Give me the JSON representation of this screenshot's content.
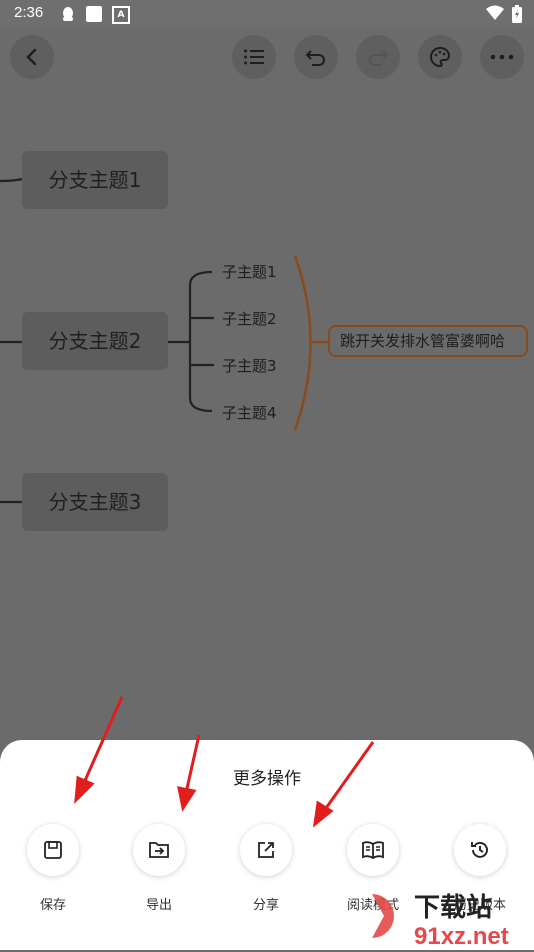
{
  "status_bar": {
    "time": "2:36"
  },
  "toolbar": {
    "back_icon": "chevron-left-icon",
    "outline_icon": "list-icon",
    "undo_icon": "undo-icon",
    "redo_icon": "redo-icon",
    "theme_icon": "palette-icon",
    "more_icon": "more-dots-icon"
  },
  "mindmap": {
    "branches": [
      "分支主题1",
      "分支主题2",
      "分支主题3"
    ],
    "subtopics": [
      "子主题1",
      "子主题2",
      "子主题3",
      "子主题4"
    ],
    "callout": "跳开关发排水管富婆啊哈"
  },
  "sheet": {
    "title": "更多操作",
    "actions": [
      {
        "label": "保存",
        "icon": "save-icon"
      },
      {
        "label": "导出",
        "icon": "export-icon"
      },
      {
        "label": "分享",
        "icon": "share-icon"
      },
      {
        "label": "阅读模式",
        "icon": "book-icon"
      },
      {
        "label": "历史版本",
        "icon": "history-icon"
      }
    ]
  },
  "watermark": {
    "brand": "下载站",
    "url": "91xz.net"
  },
  "colors": {
    "overlay": "#6b6b6b",
    "callout_border": "#8a4a1c",
    "arrow": "#e11d1d",
    "sheet": "#ffffff"
  }
}
